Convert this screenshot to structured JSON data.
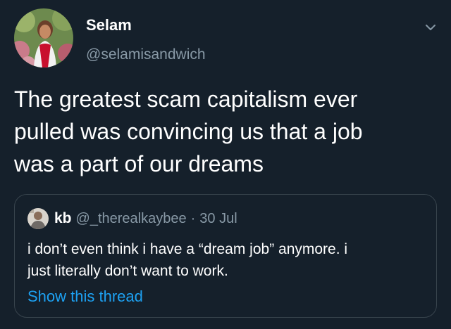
{
  "tweet": {
    "author": {
      "display_name": "Selam",
      "handle": "@selamisandwich"
    },
    "text": "The greatest scam capitalism ever\npulled was convincing us that a job\nwas a part of our dreams",
    "menu_icon": "chevron-down-icon"
  },
  "quoted_tweet": {
    "display_name": "kb",
    "handle": "@_therealkaybee",
    "separator": "·",
    "date": "30 Jul",
    "text": "i don’t even think i have a “dream job” anymore. i\njust literally don’t want to work.",
    "show_thread_label": "Show this thread"
  },
  "colors": {
    "background": "#15202b",
    "text_primary": "#ffffff",
    "text_secondary": "#8899a6",
    "link": "#1da1f2",
    "border": "#38444d"
  }
}
